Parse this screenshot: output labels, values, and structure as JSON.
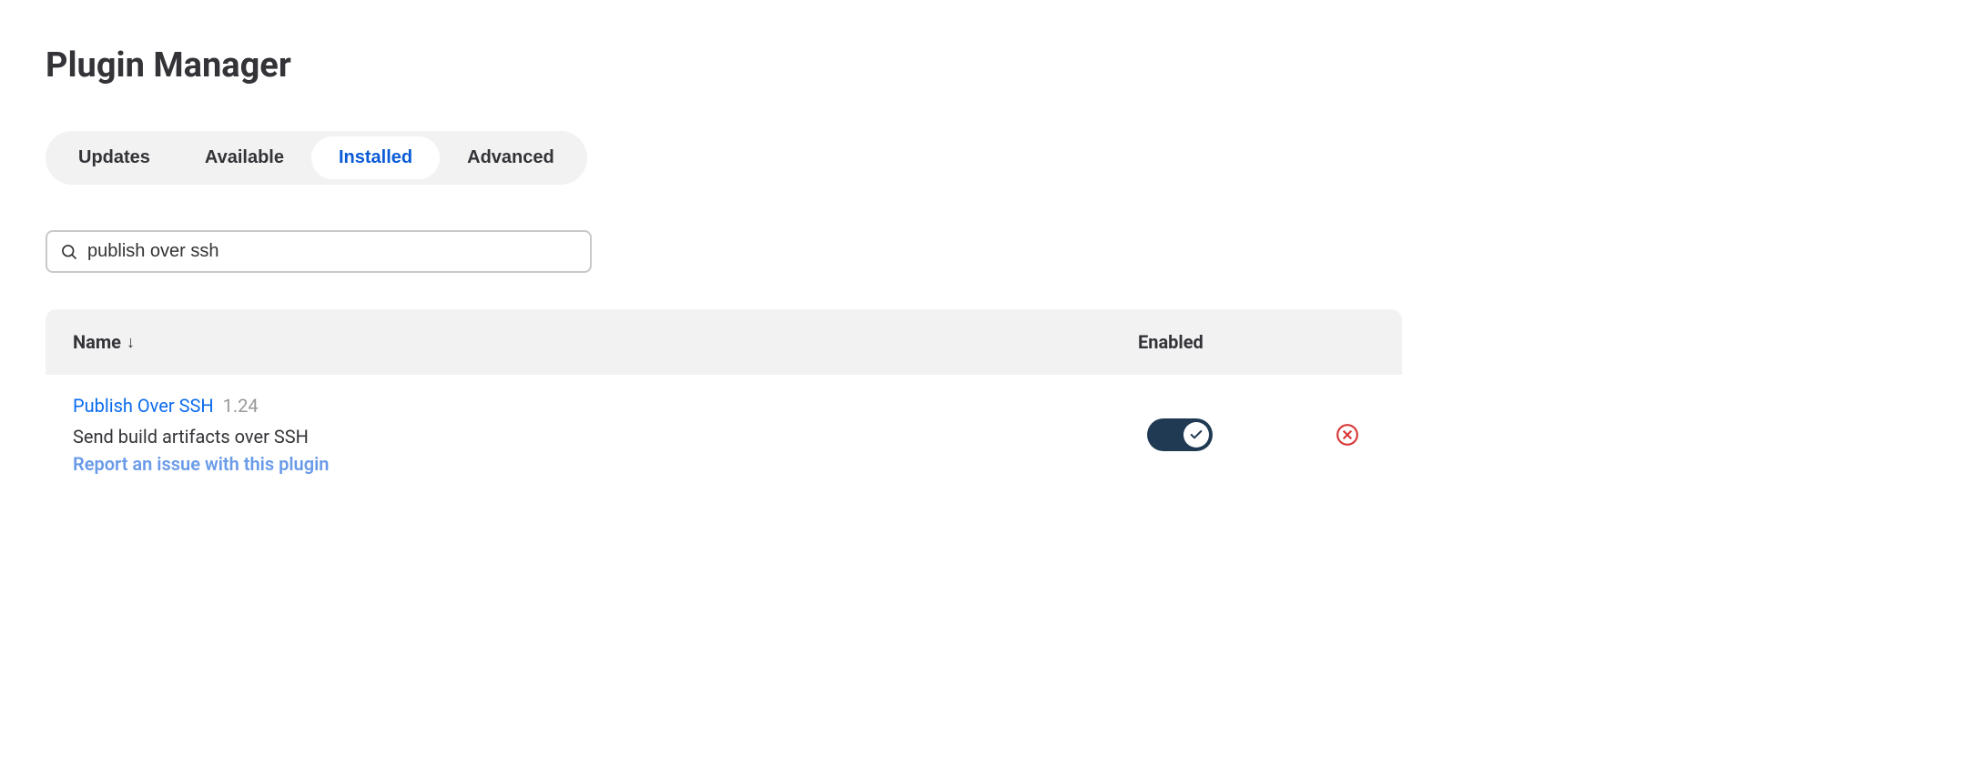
{
  "page": {
    "title": "Plugin Manager"
  },
  "tabs": [
    {
      "label": "Updates",
      "active": false
    },
    {
      "label": "Available",
      "active": false
    },
    {
      "label": "Installed",
      "active": true
    },
    {
      "label": "Advanced",
      "active": false
    }
  ],
  "search": {
    "value": "publish over ssh"
  },
  "table": {
    "headers": {
      "name": "Name",
      "sort_indicator": "↓",
      "enabled": "Enabled"
    },
    "rows": [
      {
        "name": "Publish Over SSH",
        "version": "1.24",
        "description": "Send build artifacts over SSH",
        "report_link": "Report an issue with this plugin",
        "enabled": true
      }
    ]
  }
}
